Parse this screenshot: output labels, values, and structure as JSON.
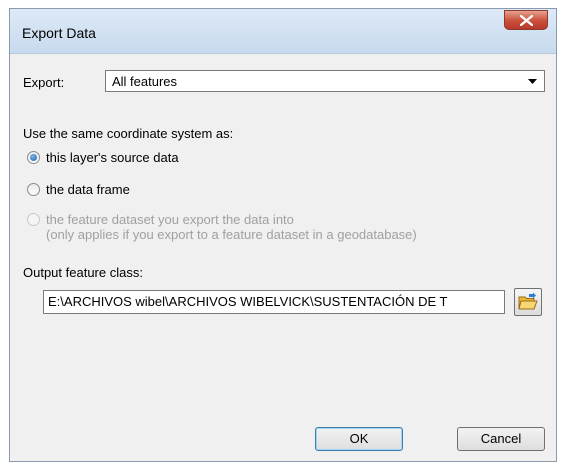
{
  "window": {
    "title": "Export Data"
  },
  "export": {
    "label": "Export:",
    "selected": "All features"
  },
  "coordinate": {
    "label": "Use the same coordinate system as:",
    "options": [
      {
        "label": "this layer's source data",
        "checked": true,
        "enabled": true
      },
      {
        "label": "the data frame",
        "checked": false,
        "enabled": true
      },
      {
        "label": "the feature dataset you export the data into",
        "sublabel": "(only applies if you export to a feature dataset in a geodatabase)",
        "checked": false,
        "enabled": false
      }
    ]
  },
  "output": {
    "label": "Output feature class:",
    "value": "E:\\ARCHIVOS wibel\\ARCHIVOS WIBELVICK\\SUSTENTACIÓN DE T"
  },
  "buttons": {
    "ok": "OK",
    "cancel": "Cancel"
  },
  "icons": {
    "close": "close-icon",
    "browse": "folder-open-icon",
    "dropdown": "chevron-down-icon"
  }
}
